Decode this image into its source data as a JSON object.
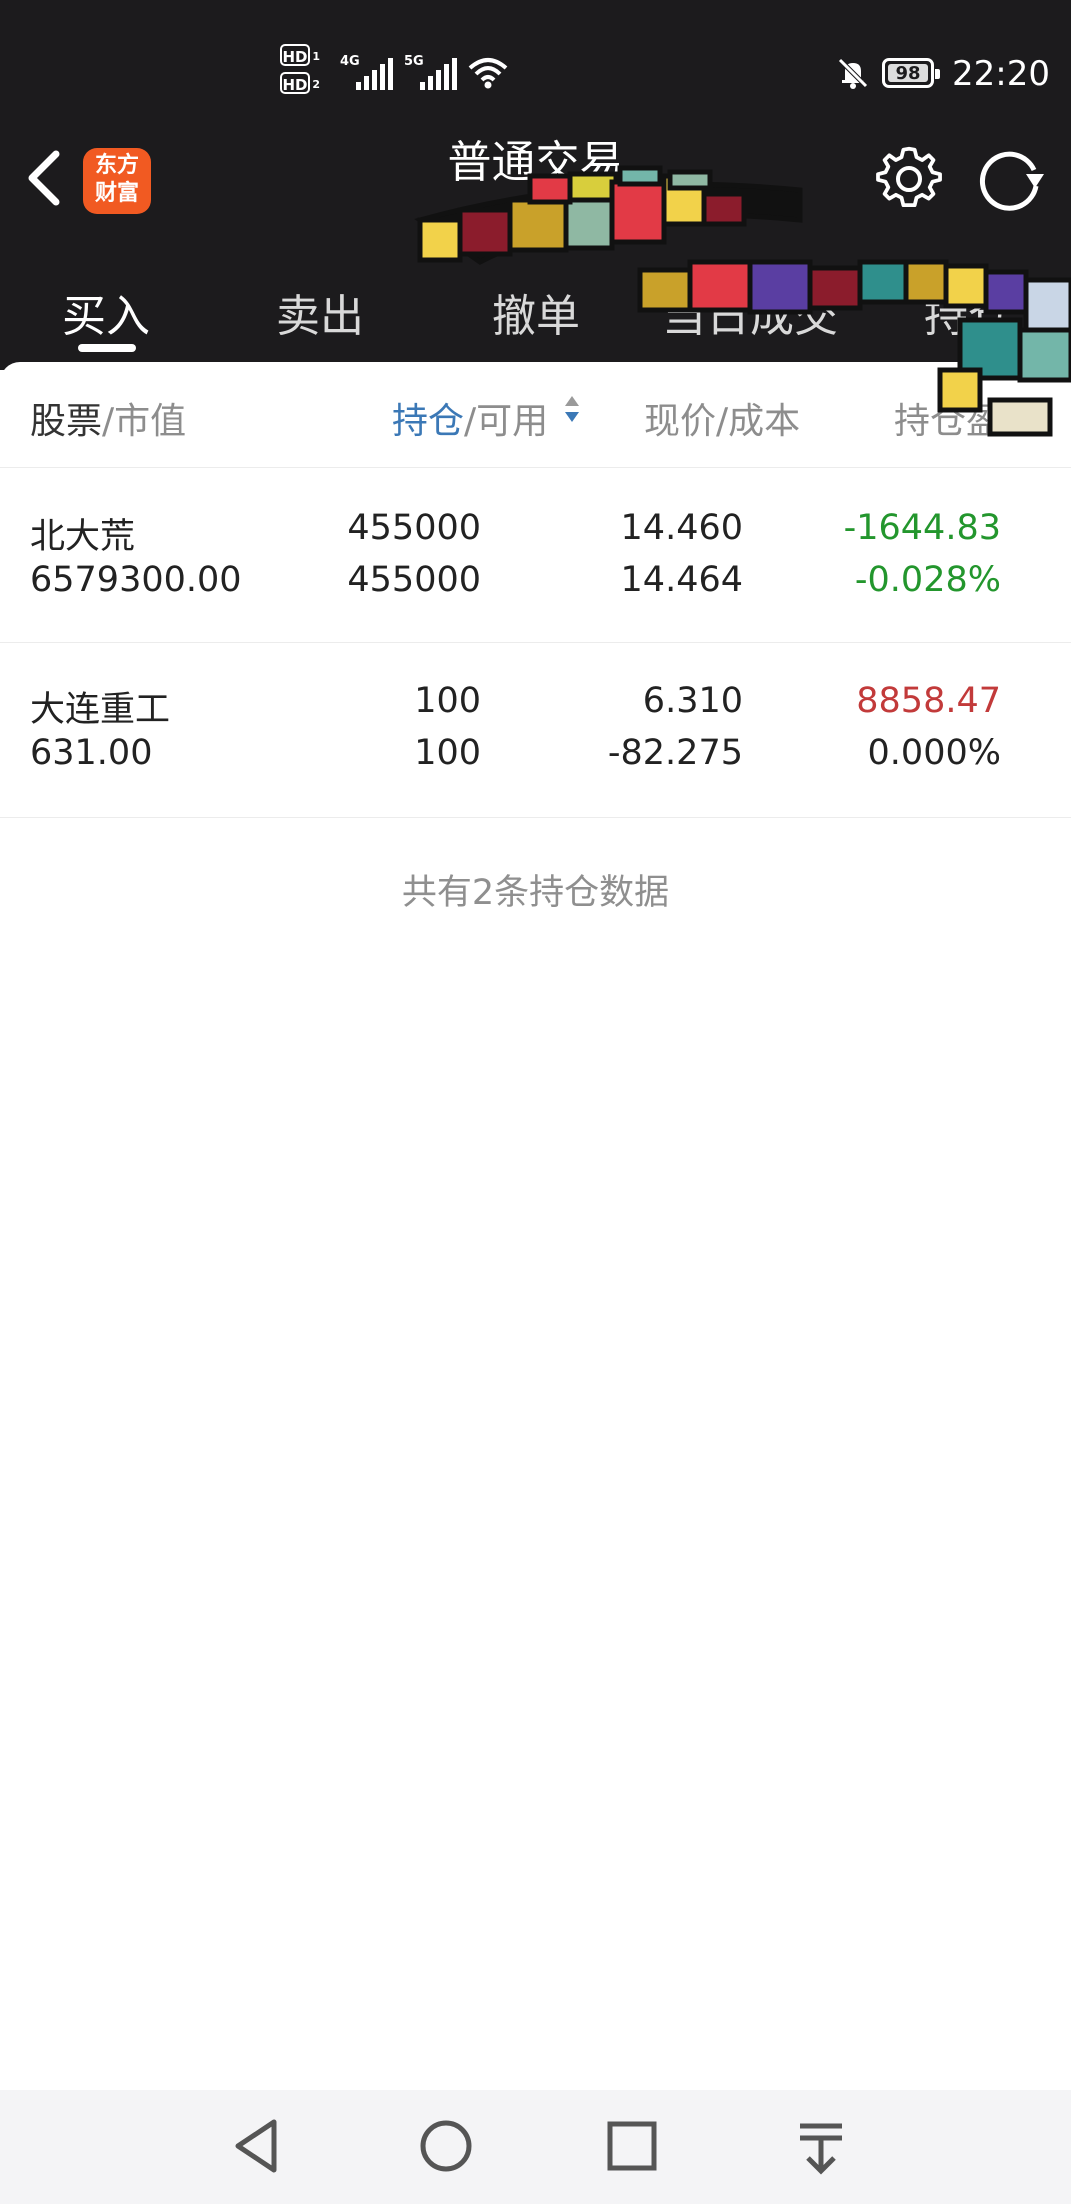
{
  "status_bar": {
    "hd1": "HD",
    "hd1_sub": "1",
    "hd2": "HD",
    "hd2_sub": "2",
    "net1": "4G",
    "net2": "5G",
    "battery": "98",
    "time": "22:20"
  },
  "header": {
    "logo_line1": "东方",
    "logo_line2": "财富",
    "title": "普通交易"
  },
  "tabs": [
    {
      "label": "买入",
      "active": true
    },
    {
      "label": "卖出",
      "active": false
    },
    {
      "label": "撤单",
      "active": false
    },
    {
      "label": "当日成交",
      "active": false
    },
    {
      "label": "持仓",
      "active": false
    }
  ],
  "columns": {
    "stock_a": "股票",
    "stock_b": "/市值",
    "hold_a": "持仓",
    "hold_b": "/可用",
    "price": "现价/成本",
    "pnl": "持仓盈亏"
  },
  "positions": [
    {
      "name": "北大荒",
      "market_value": "6579300.00",
      "hold": "455000",
      "available": "455000",
      "price": "14.460",
      "cost": "14.464",
      "pnl": "-1644.83",
      "pnl_pct": "-0.028%"
    },
    {
      "name": "大连重工",
      "market_value": "631.00",
      "hold": "100",
      "available": "100",
      "price": "6.310",
      "cost": "-82.275",
      "pnl": "8858.47",
      "pnl_pct": "0.000%"
    }
  ],
  "summary": "共有2条持仓数据",
  "colors": {
    "header_bg": "#1c1b1d",
    "accent_blue": "#3b78b6",
    "loss_green": "#23962d",
    "gain_red": "#c23a3a",
    "brand_orange": "#f15a22"
  },
  "icons": [
    "back-arrow-icon",
    "settings-gear-icon",
    "refresh-icon",
    "sort-icon",
    "nav-back-icon",
    "nav-home-icon",
    "nav-recents-icon",
    "nav-notification-icon"
  ]
}
